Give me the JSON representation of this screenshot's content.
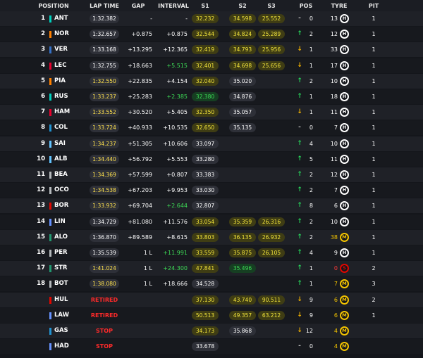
{
  "headers": {
    "position": "POSITION",
    "lap_time": "LAP TIME",
    "gap": "GAP",
    "interval": "INTERVAL",
    "s1": "S1",
    "s2": "S2",
    "s3": "S3",
    "pos": "POS",
    "tyre": "TYRE",
    "pit": "PIT"
  },
  "colors": {
    "background": "#14161b",
    "sector_personal_best": "#f3e53b",
    "sector_overall_best": "#3ddc56",
    "retired": "#ff2a2a",
    "gain": "#27d45a",
    "loss": "#f7b500",
    "hard": "#ffffff",
    "medium": "#f3c300",
    "soft": "#e10600"
  },
  "rows": [
    {
      "pos": "1",
      "code": "ANT",
      "team_color": "#00d2be",
      "lap": "1:32.382",
      "lap_best": false,
      "gap": "-",
      "interval": "-",
      "interval_green": false,
      "s1": "32.232",
      "s1c": "y",
      "s2": "34.598",
      "s2c": "y",
      "s3": "25.552",
      "s3c": "y",
      "dir": "same",
      "arrow": "-",
      "chg": "0",
      "laps": "13",
      "tyre": "H",
      "pit": "1",
      "status": ""
    },
    {
      "pos": "2",
      "code": "NOR",
      "team_color": "#ff8000",
      "lap": "1:32.657",
      "lap_best": false,
      "gap": "+0.875",
      "interval": "+0.875",
      "interval_green": false,
      "s1": "32.544",
      "s1c": "y",
      "s2": "34.824",
      "s2c": "y",
      "s3": "25.289",
      "s3c": "y",
      "dir": "up",
      "arrow": "↑",
      "chg": "2",
      "laps": "12",
      "tyre": "H",
      "pit": "1",
      "status": ""
    },
    {
      "pos": "3",
      "code": "VER",
      "team_color": "#3671c6",
      "lap": "1:33.168",
      "lap_best": false,
      "gap": "+13.295",
      "interval": "+12.365",
      "interval_green": false,
      "s1": "32.419",
      "s1c": "y",
      "s2": "34.793",
      "s2c": "y",
      "s3": "25.956",
      "s3c": "y",
      "dir": "down",
      "arrow": "↓",
      "chg": "1",
      "laps": "33",
      "tyre": "H",
      "pit": "1",
      "status": ""
    },
    {
      "pos": "4",
      "code": "LEC",
      "team_color": "#e8002d",
      "lap": "1:32.755",
      "lap_best": false,
      "gap": "+18.663",
      "interval": "+5.515",
      "interval_green": true,
      "s1": "32.401",
      "s1c": "y",
      "s2": "34.698",
      "s2c": "y",
      "s3": "25.656",
      "s3c": "y",
      "dir": "down",
      "arrow": "↓",
      "chg": "1",
      "laps": "17",
      "tyre": "H",
      "pit": "1",
      "status": ""
    },
    {
      "pos": "5",
      "code": "PIA",
      "team_color": "#ff8000",
      "lap": "1:32.550",
      "lap_best": true,
      "gap": "+22.835",
      "interval": "+4.154",
      "interval_green": false,
      "s1": "32.040",
      "s1c": "y",
      "s2": "35.020",
      "s2c": "n",
      "s3": "",
      "s3c": "",
      "dir": "up",
      "arrow": "↑",
      "chg": "2",
      "laps": "10",
      "tyre": "H",
      "pit": "1",
      "status": ""
    },
    {
      "pos": "6",
      "code": "RUS",
      "team_color": "#00d2be",
      "lap": "1:33.237",
      "lap_best": true,
      "gap": "+25.283",
      "interval": "+2.385",
      "interval_green": true,
      "s1": "32.380",
      "s1c": "g",
      "s2": "34.876",
      "s2c": "n",
      "s3": "",
      "s3c": "",
      "dir": "up",
      "arrow": "↑",
      "chg": "1",
      "laps": "18",
      "tyre": "H",
      "pit": "1",
      "status": ""
    },
    {
      "pos": "7",
      "code": "HAM",
      "team_color": "#e8002d",
      "lap": "1:33.552",
      "lap_best": true,
      "gap": "+30.520",
      "interval": "+5.405",
      "interval_green": false,
      "s1": "32.350",
      "s1c": "y",
      "s2": "35.057",
      "s2c": "n",
      "s3": "",
      "s3c": "",
      "dir": "down",
      "arrow": "↓",
      "chg": "1",
      "laps": "11",
      "tyre": "H",
      "pit": "1",
      "status": ""
    },
    {
      "pos": "8",
      "code": "COL",
      "team_color": "#2293d1",
      "lap": "1:33.724",
      "lap_best": true,
      "gap": "+40.933",
      "interval": "+10.535",
      "interval_green": false,
      "s1": "32.650",
      "s1c": "y",
      "s2": "35.135",
      "s2c": "n",
      "s3": "",
      "s3c": "",
      "dir": "same",
      "arrow": "-",
      "chg": "0",
      "laps": "7",
      "tyre": "H",
      "pit": "1",
      "status": ""
    },
    {
      "pos": "9",
      "code": "SAI",
      "team_color": "#64c4ff",
      "lap": "1:34.237",
      "lap_best": true,
      "gap": "+51.305",
      "interval": "+10.606",
      "interval_green": false,
      "s1": "33.097",
      "s1c": "n",
      "s2": "",
      "s2c": "",
      "s3": "",
      "s3c": "",
      "dir": "up",
      "arrow": "↑",
      "chg": "4",
      "laps": "10",
      "tyre": "H",
      "pit": "1",
      "status": ""
    },
    {
      "pos": "10",
      "code": "ALB",
      "team_color": "#64c4ff",
      "lap": "1:34.440",
      "lap_best": true,
      "gap": "+56.792",
      "interval": "+5.553",
      "interval_green": false,
      "s1": "33.280",
      "s1c": "n",
      "s2": "",
      "s2c": "",
      "s3": "",
      "s3c": "",
      "dir": "up",
      "arrow": "↑",
      "chg": "5",
      "laps": "11",
      "tyre": "H",
      "pit": "1",
      "status": ""
    },
    {
      "pos": "11",
      "code": "BEA",
      "team_color": "#b6babd",
      "lap": "1:34.369",
      "lap_best": true,
      "gap": "+57.599",
      "interval": "+0.807",
      "interval_green": false,
      "s1": "33.383",
      "s1c": "n",
      "s2": "",
      "s2c": "",
      "s3": "",
      "s3c": "",
      "dir": "up",
      "arrow": "↑",
      "chg": "2",
      "laps": "12",
      "tyre": "H",
      "pit": "1",
      "status": ""
    },
    {
      "pos": "12",
      "code": "OCO",
      "team_color": "#b6babd",
      "lap": "1:34.538",
      "lap_best": true,
      "gap": "+67.203",
      "interval": "+9.953",
      "interval_green": false,
      "s1": "33.030",
      "s1c": "n",
      "s2": "",
      "s2c": "",
      "s3": "",
      "s3c": "",
      "dir": "up",
      "arrow": "↑",
      "chg": "2",
      "laps": "7",
      "tyre": "H",
      "pit": "1",
      "status": ""
    },
    {
      "pos": "13",
      "code": "BOR",
      "team_color": "#e10600",
      "lap": "1:33.932",
      "lap_best": true,
      "gap": "+69.704",
      "interval": "+2.644",
      "interval_green": true,
      "s1": "32.807",
      "s1c": "n",
      "s2": "",
      "s2c": "",
      "s3": "",
      "s3c": "",
      "dir": "up",
      "arrow": "↑",
      "chg": "8",
      "laps": "6",
      "tyre": "H",
      "pit": "1",
      "status": ""
    },
    {
      "pos": "14",
      "code": "LIN",
      "team_color": "#6692ff",
      "lap": "1:34.729",
      "lap_best": false,
      "gap": "+81.080",
      "interval": "+11.576",
      "interval_green": false,
      "s1": "33.054",
      "s1c": "y",
      "s2": "35.359",
      "s2c": "y",
      "s3": "26.316",
      "s3c": "y",
      "dir": "up",
      "arrow": "↑",
      "chg": "2",
      "laps": "10",
      "tyre": "H",
      "pit": "1",
      "status": ""
    },
    {
      "pos": "15",
      "code": "ALO",
      "team_color": "#229971",
      "lap": "1:36.870",
      "lap_best": false,
      "gap": "+89.589",
      "interval": "+8.615",
      "interval_green": false,
      "s1": "33.803",
      "s1c": "y",
      "s2": "36.135",
      "s2c": "y",
      "s3": "26.932",
      "s3c": "y",
      "dir": "up",
      "arrow": "↑",
      "chg": "2",
      "laps": "38",
      "tyre": "M",
      "pit": "1",
      "status": ""
    },
    {
      "pos": "16",
      "code": "PER",
      "team_color": "#b6babd",
      "lap": "1:35.539",
      "lap_best": false,
      "gap": "1 L",
      "interval": "+11.991",
      "interval_green": true,
      "s1": "33.559",
      "s1c": "y",
      "s2": "35.875",
      "s2c": "y",
      "s3": "26.105",
      "s3c": "y",
      "dir": "up",
      "arrow": "↑",
      "chg": "4",
      "laps": "9",
      "tyre": "H",
      "pit": "1",
      "status": ""
    },
    {
      "pos": "17",
      "code": "STR",
      "team_color": "#229971",
      "lap": "1:41.024",
      "lap_best": true,
      "gap": "1 L",
      "interval": "+24.300",
      "interval_green": true,
      "s1": "47.841",
      "s1c": "y",
      "s2": "35.496",
      "s2c": "g",
      "s3": "",
      "s3c": "",
      "dir": "up",
      "arrow": "↑",
      "chg": "1",
      "laps": "0",
      "tyre": "S",
      "pit": "2",
      "status": ""
    },
    {
      "pos": "18",
      "code": "BOT",
      "team_color": "#b6babd",
      "lap": "1:38.080",
      "lap_best": true,
      "gap": "1 L",
      "interval": "+18.666",
      "interval_green": false,
      "s1": "34.528",
      "s1c": "n",
      "s2": "",
      "s2c": "",
      "s3": "",
      "s3c": "",
      "dir": "up",
      "arrow": "↑",
      "chg": "1",
      "laps": "7",
      "tyre": "M",
      "pit": "3",
      "status": ""
    },
    {
      "pos": "",
      "code": "HUL",
      "team_color": "#e10600",
      "lap": "",
      "lap_best": false,
      "gap": "",
      "interval": "",
      "interval_green": false,
      "s1": "37.130",
      "s1c": "y",
      "s2": "43.740",
      "s2c": "y",
      "s3": "90.511",
      "s3c": "y",
      "dir": "down",
      "arrow": "↓",
      "chg": "9",
      "laps": "6",
      "tyre": "M",
      "pit": "2",
      "status": "RETIRED"
    },
    {
      "pos": "",
      "code": "LAW",
      "team_color": "#6692ff",
      "lap": "",
      "lap_best": false,
      "gap": "",
      "interval": "",
      "interval_green": false,
      "s1": "50.513",
      "s1c": "y",
      "s2": "49.357",
      "s2c": "y",
      "s3": "63.212",
      "s3c": "y",
      "dir": "down",
      "arrow": "↓",
      "chg": "9",
      "laps": "6",
      "tyre": "M",
      "pit": "1",
      "status": "RETIRED"
    },
    {
      "pos": "",
      "code": "GAS",
      "team_color": "#2293d1",
      "lap": "",
      "lap_best": false,
      "gap": "",
      "interval": "",
      "interval_green": false,
      "s1": "34.173",
      "s1c": "y",
      "s2": "35.868",
      "s2c": "n",
      "s3": "",
      "s3c": "",
      "dir": "down",
      "arrow": "↓",
      "chg": "12",
      "laps": "4",
      "tyre": "M",
      "pit": "",
      "status": "STOP"
    },
    {
      "pos": "",
      "code": "HAD",
      "team_color": "#6692ff",
      "lap": "",
      "lap_best": false,
      "gap": "",
      "interval": "",
      "interval_green": false,
      "s1": "33.678",
      "s1c": "n",
      "s2": "",
      "s2c": "",
      "s3": "",
      "s3c": "",
      "dir": "same",
      "arrow": "-",
      "chg": "0",
      "laps": "4",
      "tyre": "M",
      "pit": "",
      "status": "STOP"
    }
  ]
}
